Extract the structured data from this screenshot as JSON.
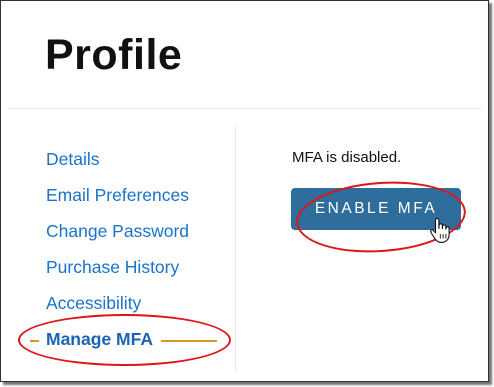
{
  "page": {
    "title": "Profile"
  },
  "sidebar": {
    "items": [
      {
        "label": "Details",
        "active": false
      },
      {
        "label": "Email Preferences",
        "active": false
      },
      {
        "label": "Change Password",
        "active": false
      },
      {
        "label": "Purchase History",
        "active": false
      },
      {
        "label": "Accessibility",
        "active": false
      },
      {
        "label": "Manage MFA",
        "active": true
      }
    ]
  },
  "mfa": {
    "status_text": "MFA is disabled.",
    "enable_button_label": "ENABLE MFA"
  },
  "colors": {
    "link": "#1a73c9",
    "button": "#2f6e9c",
    "annotation": "#e0151b",
    "active_marker": "#d9952b"
  },
  "icons": {
    "cursor": "hand-pointer-icon"
  }
}
